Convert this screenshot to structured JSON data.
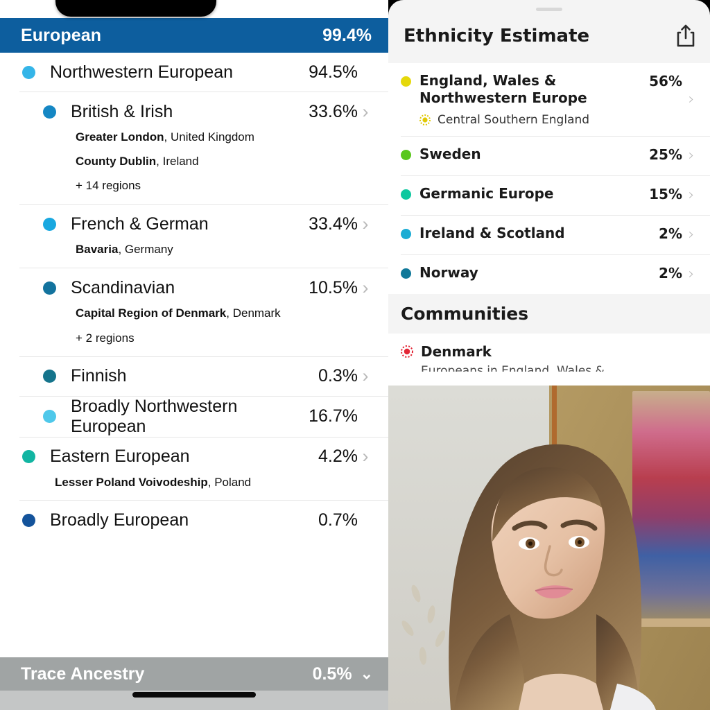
{
  "left_panel": {
    "app": "23andMe Ancestry Composition",
    "header": {
      "label": "European",
      "value": "99.4%",
      "color": "#0d5e9e"
    },
    "rows": [
      {
        "level": 1,
        "label": "Northwestern European",
        "value": "94.5%",
        "dot_color": "#35b5e8",
        "chevron": false,
        "subregions": [],
        "more": ""
      },
      {
        "level": 2,
        "label": "British & Irish",
        "value": "33.6%",
        "dot_color": "#1587c4",
        "chevron": true,
        "subregions": [
          {
            "place": "Greater London",
            "country": ", United Kingdom"
          },
          {
            "place": "County Dublin",
            "country": ", Ireland"
          }
        ],
        "more": "+ 14 regions"
      },
      {
        "level": 2,
        "label": "French & German",
        "value": "33.4%",
        "dot_color": "#19a8e0",
        "chevron": true,
        "subregions": [
          {
            "place": "Bavaria",
            "country": ", Germany"
          }
        ],
        "more": ""
      },
      {
        "level": 2,
        "label": "Scandinavian",
        "value": "10.5%",
        "dot_color": "#13739e",
        "chevron": true,
        "subregions": [
          {
            "place": "Capital Region of Denmark",
            "country": ", Denmark"
          }
        ],
        "more": "+ 2 regions"
      },
      {
        "level": 2,
        "label": "Finnish",
        "value": "0.3%",
        "dot_color": "#15748c",
        "chevron": true,
        "subregions": [],
        "more": ""
      },
      {
        "level": 2,
        "label": "Broadly Northwestern European",
        "value": "16.7%",
        "dot_color": "#4fc8ea",
        "chevron": false,
        "subregions": [],
        "more": ""
      },
      {
        "level": 1,
        "label": "Eastern European",
        "value": "4.2%",
        "dot_color": "#12b5a2",
        "chevron": true,
        "subregions": [
          {
            "place": "Lesser Poland Voivodeship",
            "country": ", Poland"
          }
        ],
        "more": ""
      },
      {
        "level": 1,
        "label": "Broadly European",
        "value": "0.7%",
        "dot_color": "#14539b",
        "chevron": false,
        "subregions": [],
        "more": ""
      }
    ],
    "trace": {
      "label": "Trace Ancestry",
      "value": "0.5%",
      "chevron": "chevron-down-icon",
      "color": "#a0a4a4"
    }
  },
  "right_panel": {
    "app": "Ancestry Ethnicity Estimate",
    "title": "Ethnicity Estimate",
    "share_icon": "share-icon",
    "ethnicities": [
      {
        "label": "England, Wales & Northwestern Europe",
        "value": "56%",
        "dot_color": "#e5d80b",
        "sub": {
          "label": "Central Southern England",
          "icon": "sunburst-icon",
          "color": "#e0c806"
        }
      },
      {
        "label": "Sweden",
        "value": "25%",
        "dot_color": "#59c71c",
        "sub": null
      },
      {
        "label": "Germanic Europe",
        "value": "15%",
        "dot_color": "#0dc89f",
        "sub": null
      },
      {
        "label": "Ireland & Scotland",
        "value": "2%",
        "dot_color": "#1cacd4",
        "sub": null
      },
      {
        "label": "Norway",
        "value": "2%",
        "dot_color": "#0f7899",
        "sub": null
      }
    ],
    "communities": {
      "heading": "Communities",
      "items": [
        {
          "name": "Denmark",
          "icon": "community-burst-icon",
          "color": "#e32636",
          "subtitle": "Europeans in England, Wales &"
        }
      ]
    },
    "photo": {
      "alt": "portrait-photo"
    }
  }
}
